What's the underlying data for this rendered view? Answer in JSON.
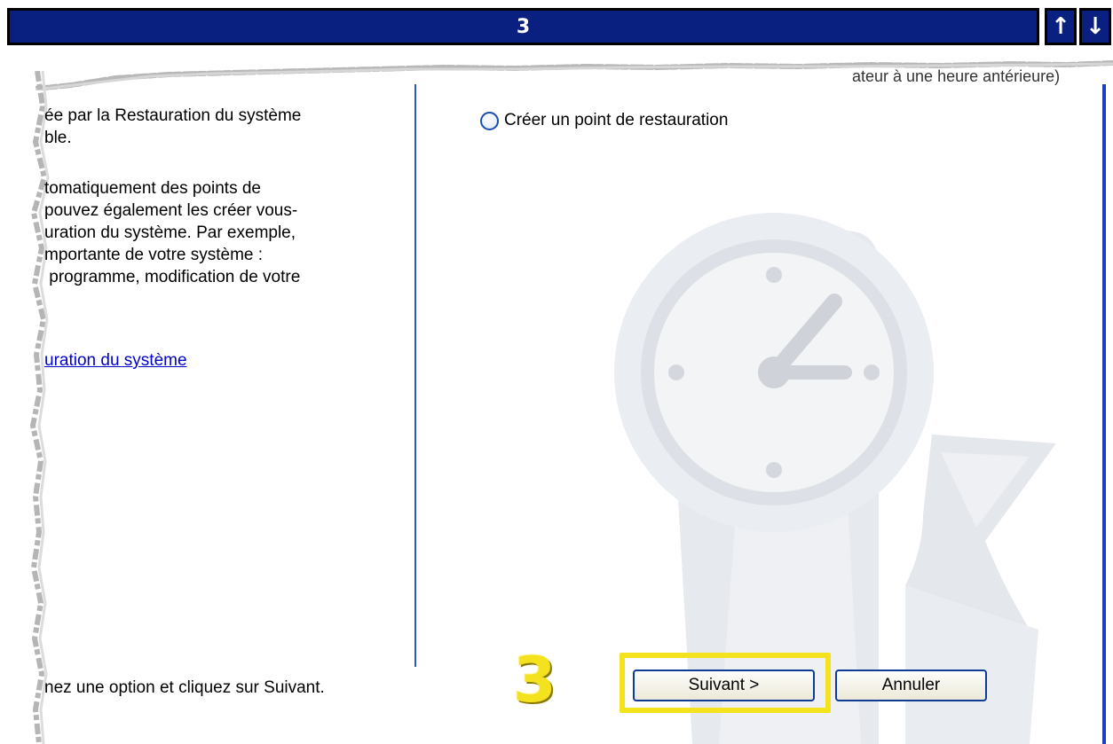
{
  "banner": {
    "step_number": "3",
    "up_arrow": "↑",
    "down_arrow": "↓"
  },
  "top_cut_text": "ateur à une heure antérieure)",
  "left_panel": {
    "para1": "ée par la Restauration du système\nble.",
    "para2": "tomatiquement des points de\npouvez également les créer vous-\nuration du système. Par exemple,\nmportante de votre système :\n programme, modification de votre",
    "help_link": "uration du système",
    "bottom_instruction": "nez une option et cliquez sur Suivant."
  },
  "right_panel": {
    "radio_option_label": "Créer un point de restauration"
  },
  "buttons": {
    "next_label": "Suivant >",
    "cancel_label": "Annuler"
  },
  "tutorial": {
    "step_marker": "3"
  },
  "colors": {
    "banner_bg": "#0a2080",
    "highlight": "#f4e21e",
    "link": "#0000cc",
    "button_border": "#0d3b96"
  },
  "icons": [
    "up-arrow-icon",
    "down-arrow-icon",
    "clock-restore-watermark-icon",
    "radio-icon"
  ]
}
